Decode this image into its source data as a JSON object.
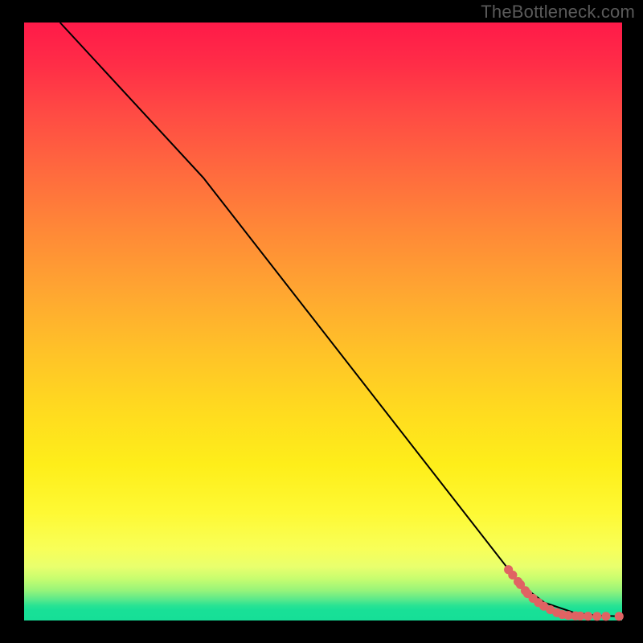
{
  "watermark": "TheBottleneck.com",
  "chart_data": {
    "type": "line",
    "title": "",
    "xlabel": "",
    "ylabel": "",
    "xlim": [
      0,
      100
    ],
    "ylim": [
      0,
      100
    ],
    "grid": false,
    "legend": false,
    "background_gradient_stops": [
      {
        "pos": 0,
        "color": "#ff1a49"
      },
      {
        "pos": 25,
        "color": "#ff6a3e"
      },
      {
        "pos": 55,
        "color": "#ffc228"
      },
      {
        "pos": 82,
        "color": "#fef934"
      },
      {
        "pos": 95,
        "color": "#96f47a"
      },
      {
        "pos": 100,
        "color": "#16df97"
      }
    ],
    "series": [
      {
        "name": "curve",
        "style": "line",
        "color": "#000000",
        "x": [
          6,
          30,
          83,
          87,
          92,
          96,
          100
        ],
        "y": [
          100,
          74,
          6,
          3,
          1.3,
          0.8,
          0.7
        ]
      },
      {
        "name": "markers",
        "style": "scatter",
        "color": "#e06363",
        "points": [
          {
            "x": 81.0,
            "y": 8.5
          },
          {
            "x": 81.7,
            "y": 7.6
          },
          {
            "x": 82.6,
            "y": 6.5
          },
          {
            "x": 83.0,
            "y": 6.0
          },
          {
            "x": 83.8,
            "y": 5.0
          },
          {
            "x": 84.2,
            "y": 4.5
          },
          {
            "x": 85.1,
            "y": 3.7
          },
          {
            "x": 86.0,
            "y": 3.0
          },
          {
            "x": 86.9,
            "y": 2.4
          },
          {
            "x": 88.0,
            "y": 1.8
          },
          {
            "x": 89.1,
            "y": 1.3
          },
          {
            "x": 90.0,
            "y": 1.0
          },
          {
            "x": 91.0,
            "y": 0.85
          },
          {
            "x": 92.2,
            "y": 0.78
          },
          {
            "x": 93.0,
            "y": 0.75
          },
          {
            "x": 94.3,
            "y": 0.72
          },
          {
            "x": 95.8,
            "y": 0.7
          },
          {
            "x": 97.3,
            "y": 0.7
          },
          {
            "x": 99.5,
            "y": 0.7
          }
        ]
      }
    ]
  }
}
